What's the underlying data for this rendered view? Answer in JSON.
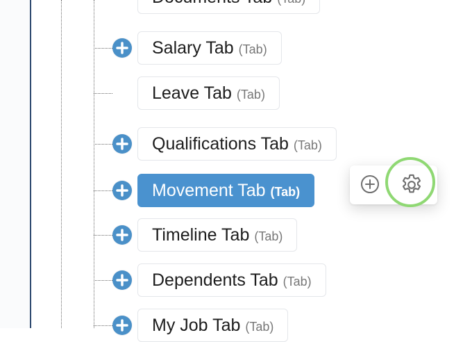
{
  "tree": {
    "nodes": [
      {
        "title": "Documents Tab",
        "type": "(Tab)",
        "selected": false,
        "expandable": false
      },
      {
        "title": "Salary Tab",
        "type": "(Tab)",
        "selected": false,
        "expandable": true
      },
      {
        "title": "Leave Tab",
        "type": "(Tab)",
        "selected": false,
        "expandable": false
      },
      {
        "title": "Qualifications Tab",
        "type": "(Tab)",
        "selected": false,
        "expandable": true
      },
      {
        "title": "Movement Tab",
        "type": "(Tab)",
        "selected": true,
        "expandable": true
      },
      {
        "title": "Timeline Tab",
        "type": "(Tab)",
        "selected": false,
        "expandable": true
      },
      {
        "title": "Dependents Tab",
        "type": "(Tab)",
        "selected": false,
        "expandable": true
      },
      {
        "title": "My Job Tab",
        "type": "(Tab)",
        "selected": false,
        "expandable": true
      }
    ],
    "expand_icon": "plus-circle-icon"
  },
  "popup": {
    "add_icon": "plus-circle-outline-icon",
    "settings_icon": "gear-icon",
    "highlight_color": "#8fd873"
  },
  "colors": {
    "accent": "#4a92cf",
    "expand_button": "#4a90c8"
  }
}
